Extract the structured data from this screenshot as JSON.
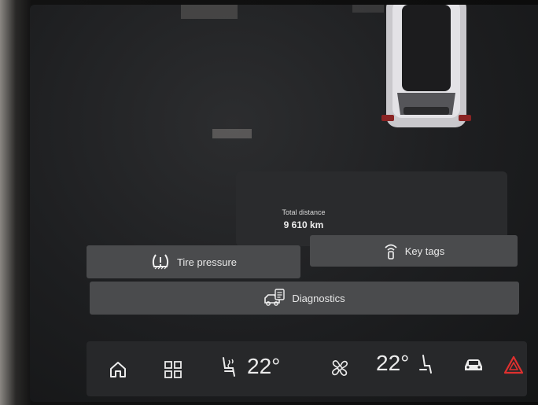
{
  "status": {
    "total_distance_label": "Total distance",
    "total_distance_value": "9 610 km"
  },
  "tiles": {
    "tire_pressure": "Tire pressure",
    "key_tags": "Key tags",
    "diagnostics": "Diagnostics"
  },
  "climate": {
    "driver_temp": "22°",
    "passenger_temp": "22°"
  },
  "icons": {
    "home": "home-icon",
    "apps": "apps-grid-icon",
    "heated_seat_driver": "heated-seat-icon",
    "fan": "fan-icon",
    "seat_passenger": "seat-icon",
    "car": "car-icon",
    "hazard": "hazard-icon",
    "tire": "tire-pressure-icon",
    "key": "key-tag-icon",
    "diagnostics": "diagnostics-icon"
  },
  "colors": {
    "hazard": "#e0302f",
    "tile": "#4a4b4d",
    "bar": "#27282a"
  }
}
